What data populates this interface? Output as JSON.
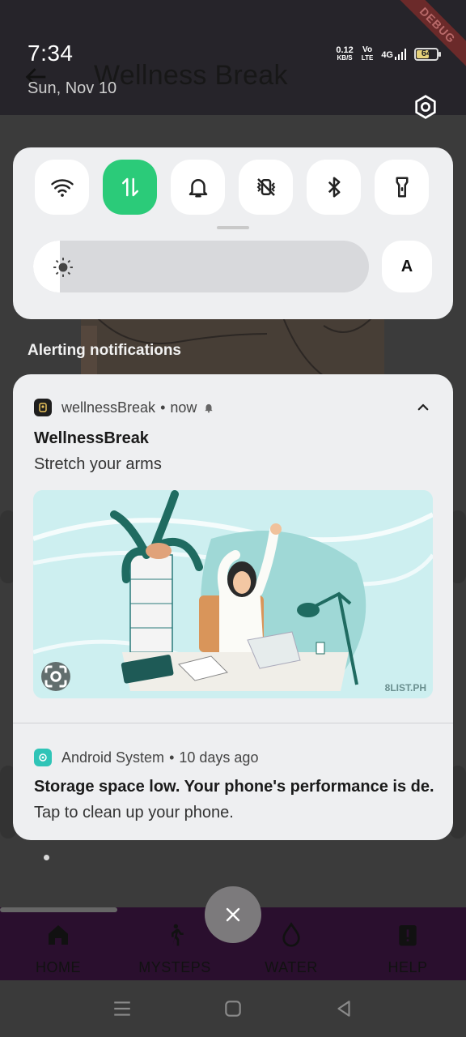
{
  "status_bar": {
    "time": "7:34",
    "date": "Sun, Nov 10",
    "net_speed_value": "0.12",
    "net_speed_unit": "KB/S",
    "volte_top": "Vo",
    "volte_bottom": "LTE",
    "network_type": "4G",
    "battery_level": "64"
  },
  "debug_banner": "DEBUG",
  "app": {
    "title": "Wellness Break",
    "bottom_nav": [
      {
        "label": "HOME",
        "icon": "home-icon"
      },
      {
        "label": "MYSTEPS",
        "icon": "walk-icon"
      },
      {
        "label": "WATER",
        "icon": "water-drop-icon"
      },
      {
        "label": "HELP",
        "icon": "help-icon"
      }
    ]
  },
  "quick_settings": {
    "tiles": [
      {
        "name": "wifi",
        "icon": "wifi-icon",
        "active": false
      },
      {
        "name": "mobile-data",
        "icon": "mobile-data-icon",
        "active": true
      },
      {
        "name": "sound",
        "icon": "bell-icon",
        "active": false
      },
      {
        "name": "vibrate",
        "icon": "vibrate-icon",
        "active": false
      },
      {
        "name": "bluetooth",
        "icon": "bluetooth-icon",
        "active": false
      },
      {
        "name": "flashlight",
        "icon": "flashlight-icon",
        "active": false
      }
    ],
    "brightness_level": 0.08,
    "auto_brightness_label": "A"
  },
  "notifications": {
    "section_label": "Alerting notifications",
    "items": [
      {
        "app_name": "wellnessBreak",
        "separator": "•",
        "time": "now",
        "title": "WellnessBreak",
        "text": "Stretch your arms",
        "image_watermark": "8LIST.PH"
      },
      {
        "app_name": "Android System",
        "separator": "•",
        "time": "10 days ago",
        "title": "Storage space low. Your phone's performance is de..",
        "text": "Tap to clean up your phone."
      }
    ]
  },
  "colors": {
    "accent_green": "#2bcb79",
    "panel_bg": "#eeeff1",
    "scrim": "#3a3a3a"
  }
}
